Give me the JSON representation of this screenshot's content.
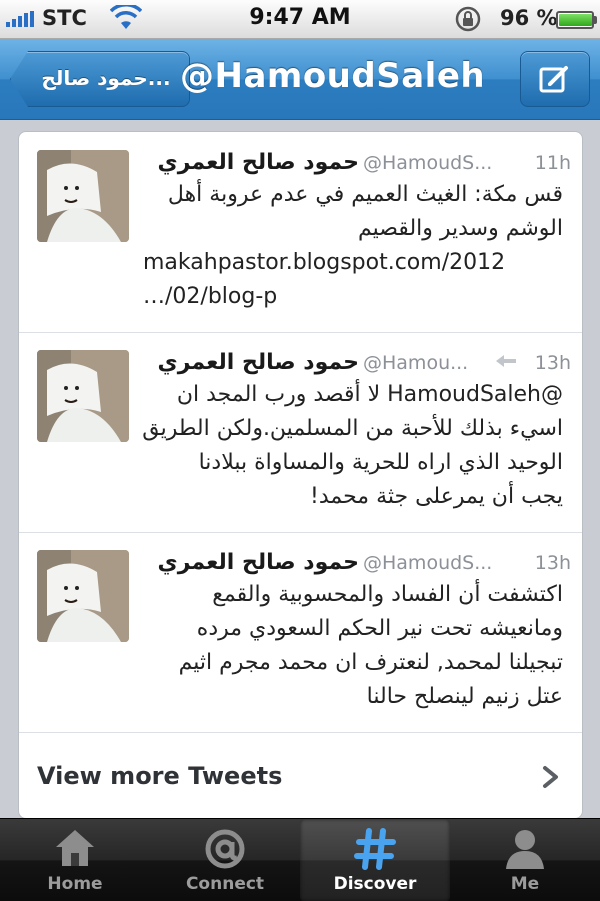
{
  "status_bar": {
    "carrier": "STC",
    "time": "9:47 AM",
    "battery_percent": "96 %",
    "battery_level": 0.96
  },
  "nav": {
    "back_label": "حمود صالح...",
    "title": "@HamoudSaleh",
    "compose_icon": "compose-icon"
  },
  "tweets": [
    {
      "name": "حمود صالح العمري",
      "handle": "@HamoudS...",
      "time": "11h",
      "retweet_icon": false,
      "lines": [
        "قس مكة: الغيث العميم في عدم عروبة أهل",
        "الوشم وسدير والقصيم",
        "makahpastor.blogspot.com/2012",
        "…/02/blog-p"
      ]
    },
    {
      "name": "حمود صالح العمري",
      "handle": "@Hamou...",
      "time": "13h",
      "retweet_icon": true,
      "lines": [
        "@HamoudSaleh لا أقصد ورب المجد ان",
        "اسيء بذلك للأحبة من المسلمين.ولكن الطريق",
        "الوحيد الذي اراه للحرية والمساواة ببلادنا",
        "يجب أن يمرعلى جثة محمد!"
      ]
    },
    {
      "name": "حمود صالح العمري",
      "handle": "@HamoudS...",
      "time": "13h",
      "retweet_icon": false,
      "lines": [
        "اكتشفت أن الفساد والمحسوبية والقمع",
        "ومانعيشه تحت نير الحكم السعودي مرده",
        "تبجيلنا لمحمد, لنعترف ان محمد مجرم اثيم",
        "عتل زنيم لينصلح حالنا"
      ]
    }
  ],
  "view_more": "View more Tweets",
  "tabs": [
    {
      "label": "Home",
      "icon": "home-icon"
    },
    {
      "label": "Connect",
      "icon": "at-icon"
    },
    {
      "label": "Discover",
      "icon": "hash-icon",
      "active": true
    },
    {
      "label": "Me",
      "icon": "person-icon"
    }
  ],
  "colors": {
    "nav_blue": "#2c7dc0",
    "tab_bar": "#141414",
    "accent_blue": "#4aa3ef"
  }
}
